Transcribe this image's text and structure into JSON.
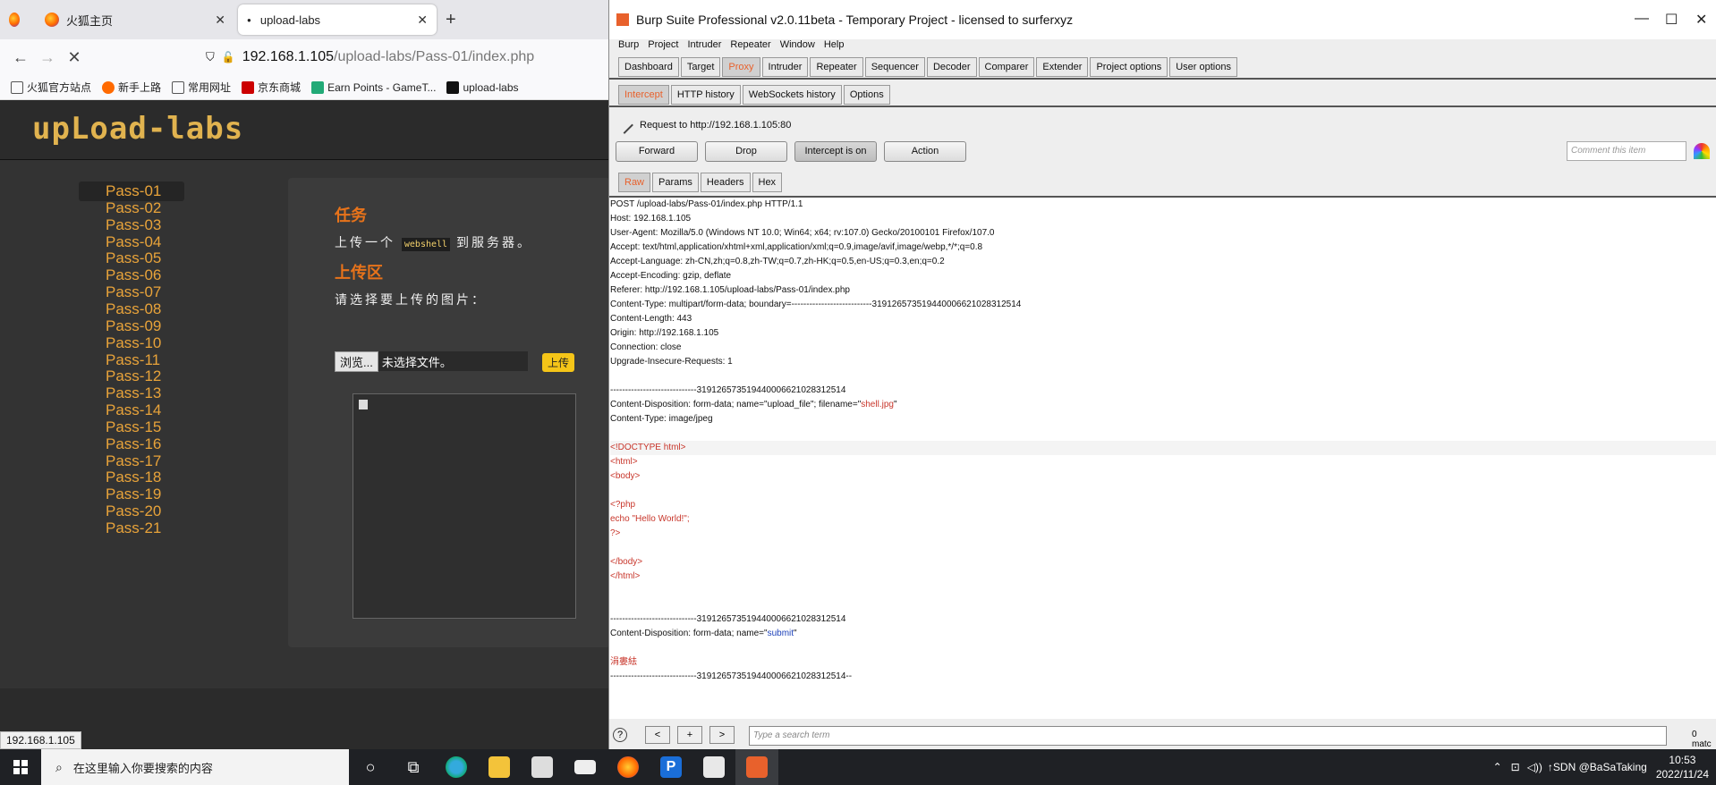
{
  "firefox": {
    "tabs": [
      {
        "label": "火狐主页"
      },
      {
        "label": "upload-labs"
      }
    ],
    "url_host": "192.168.1.105",
    "url_path": "/upload-labs/Pass-01/index.php",
    "bookmarks": [
      "火狐官方站点",
      "新手上路",
      "常用网址",
      "京东商城",
      "Earn Points - GameT...",
      "upload-labs"
    ],
    "status_url": "192.168.1.105"
  },
  "upload_labs": {
    "logo": "upLoad-labs",
    "passes": [
      "Pass-01",
      "Pass-02",
      "Pass-03",
      "Pass-04",
      "Pass-05",
      "Pass-06",
      "Pass-07",
      "Pass-08",
      "Pass-09",
      "Pass-10",
      "Pass-11",
      "Pass-12",
      "Pass-13",
      "Pass-14",
      "Pass-15",
      "Pass-16",
      "Pass-17",
      "Pass-18",
      "Pass-19",
      "Pass-20",
      "Pass-21"
    ],
    "task_title": "任务",
    "task_text_before": "上传一个",
    "task_code": "webshell",
    "task_text_after": "到服务器。",
    "upload_title": "上传区",
    "choose_text": "请选择要上传的图片：",
    "browse_label": "浏览...",
    "no_file": "未选择文件。",
    "upload_label": "上传"
  },
  "burp": {
    "title": "Burp Suite Professional v2.0.11beta - Temporary Project - licensed to surferxyz",
    "menu": [
      "Burp",
      "Project",
      "Intruder",
      "Repeater",
      "Window",
      "Help"
    ],
    "main_tabs": [
      "Dashboard",
      "Target",
      "Proxy",
      "Intruder",
      "Repeater",
      "Sequencer",
      "Decoder",
      "Comparer",
      "Extender",
      "Project options",
      "User options"
    ],
    "proxy_tabs": [
      "Intercept",
      "HTTP history",
      "WebSockets history",
      "Options"
    ],
    "request_to": "Request to http://192.168.1.105:80",
    "buttons": {
      "forward": "Forward",
      "drop": "Drop",
      "intercept": "Intercept is on",
      "action": "Action"
    },
    "comment_placeholder": "Comment this item",
    "editor_tabs": [
      "Raw",
      "Params",
      "Headers",
      "Hex"
    ],
    "request_lines": [
      "POST /upload-labs/Pass-01/index.php HTTP/1.1",
      "Host: 192.168.1.105",
      "User-Agent: Mozilla/5.0 (Windows NT 10.0; Win64; x64; rv:107.0) Gecko/20100101 Firefox/107.0",
      "Accept: text/html,application/xhtml+xml,application/xml;q=0.9,image/avif,image/webp,*/*;q=0.8",
      "Accept-Language: zh-CN,zh;q=0.8,zh-TW;q=0.7,zh-HK;q=0.5,en-US;q=0.3,en;q=0.2",
      "Accept-Encoding: gzip, deflate",
      "Referer: http://192.168.1.105/upload-labs/Pass-01/index.php",
      "Content-Type: multipart/form-data; boundary=---------------------------319126573519440006621028312514",
      "Content-Length: 443",
      "Origin: http://192.168.1.105",
      "Connection: close",
      "Upgrade-Insecure-Requests: 1",
      "",
      "-----------------------------319126573519440006621028312514",
      "Content-Disposition: form-data; name=\"upload_file\"; filename=\"",
      "Content-Type: image/jpeg",
      "",
      "<!DOCTYPE html>",
      "<html>",
      "<body>",
      "",
      "<?php",
      "echo \"Hello World!\";",
      "?>",
      "",
      "</body>",
      "</html>",
      "",
      "",
      "-----------------------------319126573519440006621028312514",
      "Content-Disposition: form-data; name=\"",
      "",
      "涓婁紶",
      "-----------------------------319126573519440006621028312514--"
    ],
    "filename_value": "shell.jpg",
    "submit_value": "submit",
    "search_placeholder": "Type a search term",
    "matches": "0 matc"
  },
  "taskbar": {
    "search_placeholder": "在这里输入你要搜索的内容",
    "time": "10:53",
    "date": "2022/11/24",
    "tray_text": "CSDN @BaSaTaking",
    "csdn": "↑SDN @BaSaTaking"
  }
}
